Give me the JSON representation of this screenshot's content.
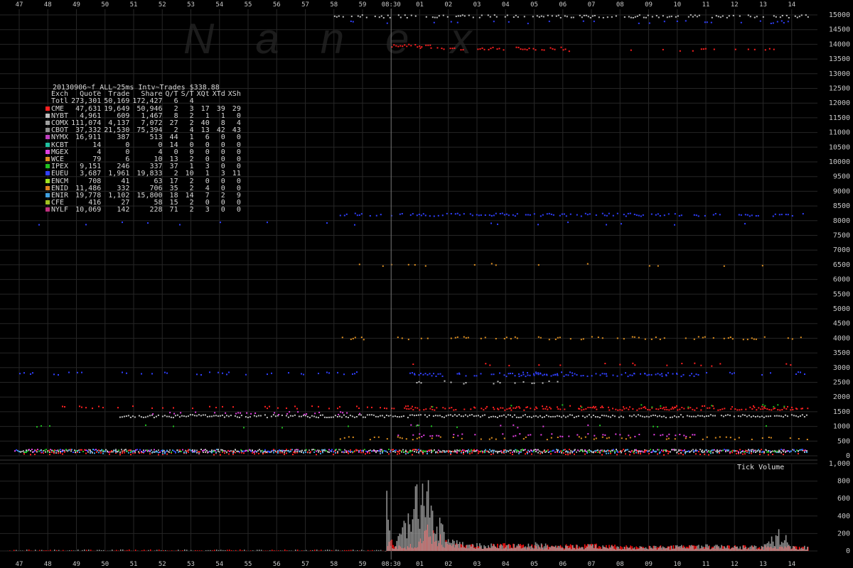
{
  "watermark": "Nanex",
  "stats": {
    "title": "20130906~f_ALL~25ms Intv~Trades $338.88",
    "columns": [
      "Exch",
      "Quote",
      "Trade",
      "Share",
      "Q/T",
      "S/T",
      "XQt",
      "XTd",
      "XSh"
    ],
    "total": {
      "exch": "Totl",
      "quote": "273,301",
      "trade": "50,169",
      "share": "172,427",
      "qt": "6",
      "st": "4",
      "xqt": "",
      "xtd": "",
      "xsh": ""
    },
    "rows": [
      {
        "exch": "CME",
        "color": "#ff2020",
        "quote": "47,631",
        "trade": "19,649",
        "share": "50,946",
        "qt": "2",
        "st": "3",
        "xqt": "17",
        "xtd": "39",
        "xsh": "29"
      },
      {
        "exch": "NYBT",
        "color": "#c0c0c0",
        "quote": "4,961",
        "trade": "609",
        "share": "1,467",
        "qt": "8",
        "st": "2",
        "xqt": "1",
        "xtd": "1",
        "xsh": "0"
      },
      {
        "exch": "COMX",
        "color": "#a0a0a0",
        "quote": "111,074",
        "trade": "4,137",
        "share": "7,072",
        "qt": "27",
        "st": "2",
        "xqt": "40",
        "xtd": "8",
        "xsh": "4"
      },
      {
        "exch": "CBOT",
        "color": "#909090",
        "quote": "37,332",
        "trade": "21,530",
        "share": "75,394",
        "qt": "2",
        "st": "4",
        "xqt": "13",
        "xtd": "42",
        "xsh": "43"
      },
      {
        "exch": "NYMX",
        "color": "#c040c0",
        "quote": "16,911",
        "trade": "387",
        "share": "513",
        "qt": "44",
        "st": "1",
        "xqt": "6",
        "xtd": "0",
        "xsh": "0"
      },
      {
        "exch": "KCBT",
        "color": "#20c0a0",
        "quote": "14",
        "trade": "0",
        "share": "0",
        "qt": "14",
        "st": "0",
        "xqt": "0",
        "xtd": "0",
        "xsh": "0"
      },
      {
        "exch": "MGEX",
        "color": "#e040e0",
        "quote": "4",
        "trade": "0",
        "share": "4",
        "qt": "0",
        "st": "0",
        "xqt": "0",
        "xtd": "0",
        "xsh": "0"
      },
      {
        "exch": "WCE",
        "color": "#e09020",
        "quote": "79",
        "trade": "6",
        "share": "10",
        "qt": "13",
        "st": "2",
        "xqt": "0",
        "xtd": "0",
        "xsh": "0"
      },
      {
        "exch": "IPEX",
        "color": "#20c020",
        "quote": "9,151",
        "trade": "246",
        "share": "337",
        "qt": "37",
        "st": "1",
        "xqt": "3",
        "xtd": "0",
        "xsh": "0"
      },
      {
        "exch": "EUEU",
        "color": "#3040ff",
        "quote": "3,687",
        "trade": "1,961",
        "share": "19,833",
        "qt": "2",
        "st": "10",
        "xqt": "1",
        "xtd": "3",
        "xsh": "11"
      },
      {
        "exch": "ENCM",
        "color": "#a0e020",
        "quote": "708",
        "trade": "41",
        "share": "63",
        "qt": "17",
        "st": "2",
        "xqt": "0",
        "xtd": "0",
        "xsh": "0"
      },
      {
        "exch": "ENID",
        "color": "#e08020",
        "quote": "11,486",
        "trade": "332",
        "share": "706",
        "qt": "35",
        "st": "2",
        "xqt": "4",
        "xtd": "0",
        "xsh": "0"
      },
      {
        "exch": "ENIR",
        "color": "#40a0e0",
        "quote": "19,778",
        "trade": "1,102",
        "share": "15,800",
        "qt": "18",
        "st": "14",
        "xqt": "7",
        "xtd": "2",
        "xsh": "9"
      },
      {
        "exch": "CFE",
        "color": "#a0c020",
        "quote": "416",
        "trade": "27",
        "share": "58",
        "qt": "15",
        "st": "2",
        "xqt": "0",
        "xtd": "0",
        "xsh": "0"
      },
      {
        "exch": "NYLF",
        "color": "#c03080",
        "quote": "10,069",
        "trade": "142",
        "share": "228",
        "qt": "71",
        "st": "2",
        "xqt": "3",
        "xtd": "0",
        "xsh": "0"
      }
    ]
  },
  "chart_data": [
    {
      "type": "scatter",
      "y_ticks": [
        "15000",
        "14500",
        "14000",
        "13500",
        "13000",
        "12500",
        "12000",
        "11500",
        "11000",
        "10500",
        "10000",
        "9500",
        "9000",
        "8500",
        "8000",
        "7500",
        "7000",
        "6500",
        "6000",
        "5500",
        "5000",
        "4500",
        "4000",
        "3500",
        "3000",
        "2500",
        "2000",
        "1500",
        "1000",
        "500",
        "0"
      ],
      "ylim": [
        0,
        15000
      ],
      "x_ticks": [
        "47",
        "48",
        "49",
        "50",
        "51",
        "52",
        "53",
        "54",
        "55",
        "56",
        "57",
        "58",
        "59",
        "08:30",
        "01",
        "02",
        "03",
        "04",
        "05",
        "06",
        "07",
        "08",
        "09",
        "10",
        "11",
        "12",
        "13",
        "14"
      ],
      "marker_time": "08:30",
      "series": [
        {
          "color": "#ff2020",
          "bands": [
            {
              "y": 13950,
              "from": 13.0,
              "to": 14.4,
              "density": 0.9
            },
            {
              "y": 13850,
              "from": 14.0,
              "to": 19.2,
              "density": 0.5
            },
            {
              "y": 13800,
              "from": 19.2,
              "to": 27.6,
              "density": 0.15
            },
            {
              "y": 3100,
              "from": 13.0,
              "to": 27.6,
              "density": 0.1
            },
            {
              "y": 1650,
              "from": 0.0,
              "to": 27.6,
              "density": 0.2
            },
            {
              "y": 1600,
              "from": 13.0,
              "to": 27.6,
              "density": 0.7
            },
            {
              "y": 80,
              "from": 0.0,
              "to": 27.6,
              "density": 0.5
            }
          ]
        },
        {
          "color": "#3040ff",
          "bands": [
            {
              "y": 14750,
              "from": 11.2,
              "to": 27.6,
              "density": 0.12
            },
            {
              "y": 8200,
              "from": 11.2,
              "to": 27.6,
              "density": 0.55
            },
            {
              "y": 7900,
              "from": 0.0,
              "to": 27.6,
              "density": 0.04
            },
            {
              "y": 2800,
              "from": 0.0,
              "to": 27.6,
              "density": 0.2
            },
            {
              "y": 2750,
              "from": 13.8,
              "to": 24.0,
              "density": 0.6
            }
          ]
        },
        {
          "color": "#c0c0c0",
          "bands": [
            {
              "y": 14950,
              "from": 11.0,
              "to": 27.6,
              "density": 0.55
            },
            {
              "y": 1350,
              "from": 3.5,
              "to": 27.6,
              "density": 0.92
            },
            {
              "y": 2500,
              "from": 13.8,
              "to": 19.0,
              "density": 0.25
            },
            {
              "y": 150,
              "from": 0.0,
              "to": 27.6,
              "density": 0.75
            }
          ]
        },
        {
          "color": "#e09020",
          "bands": [
            {
              "y": 6500,
              "from": 11.2,
              "to": 27.6,
              "density": 0.12
            },
            {
              "y": 4000,
              "from": 11.2,
              "to": 27.6,
              "density": 0.3
            },
            {
              "y": 600,
              "from": 11.2,
              "to": 27.6,
              "density": 0.25
            }
          ]
        },
        {
          "color": "#e040e0",
          "bands": [
            {
              "y": 1450,
              "from": 4.5,
              "to": 12.0,
              "density": 0.3
            },
            {
              "y": 700,
              "from": 13.0,
              "to": 24.0,
              "density": 0.3
            },
            {
              "y": 1000,
              "from": 13.0,
              "to": 20.0,
              "density": 0.1
            }
          ]
        },
        {
          "color": "#20c020",
          "bands": [
            {
              "y": 1000,
              "from": 0.0,
              "to": 27.6,
              "density": 0.04
            },
            {
              "y": 1700,
              "from": 13.0,
              "to": 27.6,
              "density": 0.05
            }
          ]
        },
        {
          "color": "#40a0e0",
          "bands": [
            {
              "y": 120,
              "from": 0.0,
              "to": 27.6,
              "density": 0.2
            }
          ]
        }
      ]
    },
    {
      "type": "bar",
      "title": "Tick Volume",
      "y_ticks": [
        "1,000",
        "800",
        "600",
        "400",
        "200",
        "0"
      ],
      "ylim": [
        0,
        1000
      ],
      "x_ticks": [
        "47",
        "48",
        "49",
        "50",
        "51",
        "52",
        "53",
        "54",
        "55",
        "56",
        "57",
        "58",
        "59",
        "08:30",
        "01",
        "02",
        "03",
        "04",
        "05",
        "06",
        "07",
        "08",
        "09",
        "10",
        "11",
        "12",
        "13",
        "14"
      ],
      "marker_time": "08:30",
      "series": [
        {
          "name": "",
          "color": "#ff1010",
          "values": [
            [
              12.8,
              0
            ],
            [
              12.9,
              110
            ],
            [
              13.0,
              220
            ],
            [
              13.2,
              60
            ],
            [
              13.5,
              40
            ],
            [
              14.0,
              140
            ],
            [
              14.3,
              320
            ],
            [
              14.6,
              200
            ],
            [
              15.0,
              90
            ],
            [
              16.0,
              70
            ],
            [
              17.0,
              80
            ],
            [
              18.0,
              65
            ],
            [
              19.0,
              70
            ],
            [
              20.0,
              75
            ],
            [
              21.0,
              60
            ],
            [
              22.0,
              55
            ],
            [
              23.0,
              60
            ],
            [
              24.0,
              55
            ],
            [
              25.0,
              60
            ],
            [
              26.0,
              55
            ],
            [
              27.0,
              50
            ],
            [
              27.6,
              40
            ]
          ]
        },
        {
          "name": "",
          "color": "#a0a0a0",
          "values": [
            [
              12.78,
              0
            ],
            [
              12.82,
              860
            ],
            [
              12.88,
              700
            ],
            [
              12.95,
              180
            ],
            [
              13.05,
              30
            ],
            [
              14.25,
              980
            ],
            [
              14.35,
              850
            ],
            [
              14.45,
              620
            ],
            [
              14.6,
              420
            ],
            [
              14.8,
              260
            ],
            [
              15.0,
              120
            ],
            [
              16.0,
              80
            ],
            [
              17.0,
              70
            ],
            [
              18.0,
              90
            ],
            [
              19.0,
              60
            ],
            [
              20.0,
              70
            ],
            [
              21.0,
              60
            ],
            [
              22.0,
              50
            ],
            [
              23.0,
              60
            ],
            [
              24.0,
              70
            ],
            [
              25.0,
              55
            ],
            [
              26.0,
              60
            ],
            [
              26.6,
              260
            ],
            [
              27.0,
              50
            ],
            [
              27.6,
              60
            ]
          ]
        }
      ]
    }
  ]
}
